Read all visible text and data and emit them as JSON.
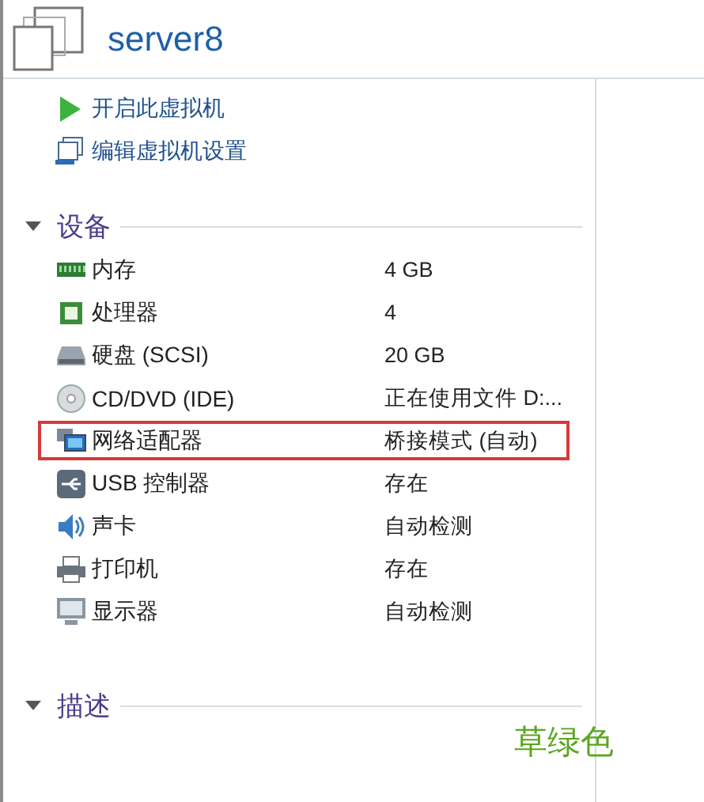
{
  "window": {
    "title": "server8"
  },
  "actions": [
    {
      "kind": "play",
      "label": "开启此虚拟机"
    },
    {
      "kind": "settings",
      "label": "编辑虚拟机设置"
    }
  ],
  "devices_section": {
    "title": "设备",
    "expanded": true
  },
  "devices": [
    {
      "kind": "memory",
      "name": "内存",
      "value": "4 GB",
      "highlighted": false
    },
    {
      "kind": "cpu",
      "name": "处理器",
      "value": "4",
      "highlighted": false
    },
    {
      "kind": "disk",
      "name": "硬盘 (SCSI)",
      "value": "20 GB",
      "highlighted": false
    },
    {
      "kind": "cdrom",
      "name": "CD/DVD (IDE)",
      "value": "正在使用文件 D:...",
      "highlighted": false
    },
    {
      "kind": "network",
      "name": "网络适配器",
      "value": "桥接模式 (自动)",
      "highlighted": true
    },
    {
      "kind": "usb",
      "name": "USB 控制器",
      "value": "存在",
      "highlighted": false
    },
    {
      "kind": "sound",
      "name": "声卡",
      "value": "自动检测",
      "highlighted": false
    },
    {
      "kind": "printer",
      "name": "打印机",
      "value": "存在",
      "highlighted": false
    },
    {
      "kind": "display",
      "name": "显示器",
      "value": "自动检测",
      "highlighted": false
    }
  ],
  "description_section": {
    "title": "描述",
    "expanded": true
  },
  "annotation": "草绿色"
}
